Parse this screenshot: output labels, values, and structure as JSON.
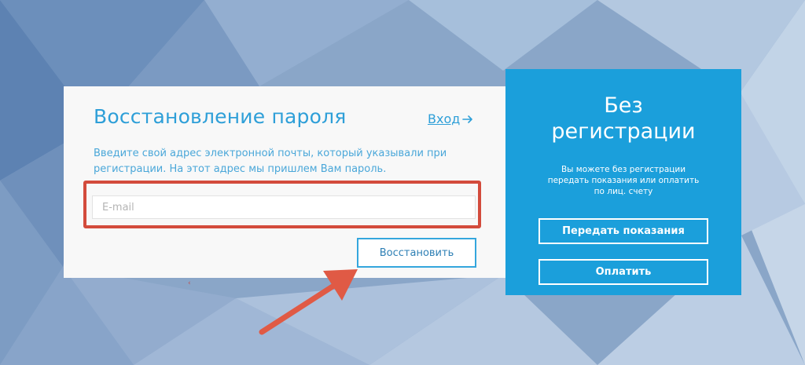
{
  "recovery": {
    "title": "Восстановление пароля",
    "login_link": "Вход",
    "description": "Введите свой адрес электронной почты, который указывали при регистрации. На этот адрес мы пришлем Вам пароль.",
    "email_placeholder": "E-mail",
    "email_value": "",
    "restore_label": "Восстановить"
  },
  "small_mark": "‹",
  "guest": {
    "title_line1": "Без",
    "title_line2": "регистрации",
    "description": "Вы можете без регистрации передать показания или оплатить по лиц. счету",
    "readings_label": "Передать показания",
    "pay_label": "Оплатить"
  },
  "colors": {
    "accent": "#2e9fd8",
    "guest_panel": "#1b9fdb",
    "highlight": "#d34b3c",
    "card_bg": "#f8f8f8"
  },
  "icons": {
    "login_arrow": "arrow-right-icon",
    "pointer": "annotation-arrow-icon"
  }
}
